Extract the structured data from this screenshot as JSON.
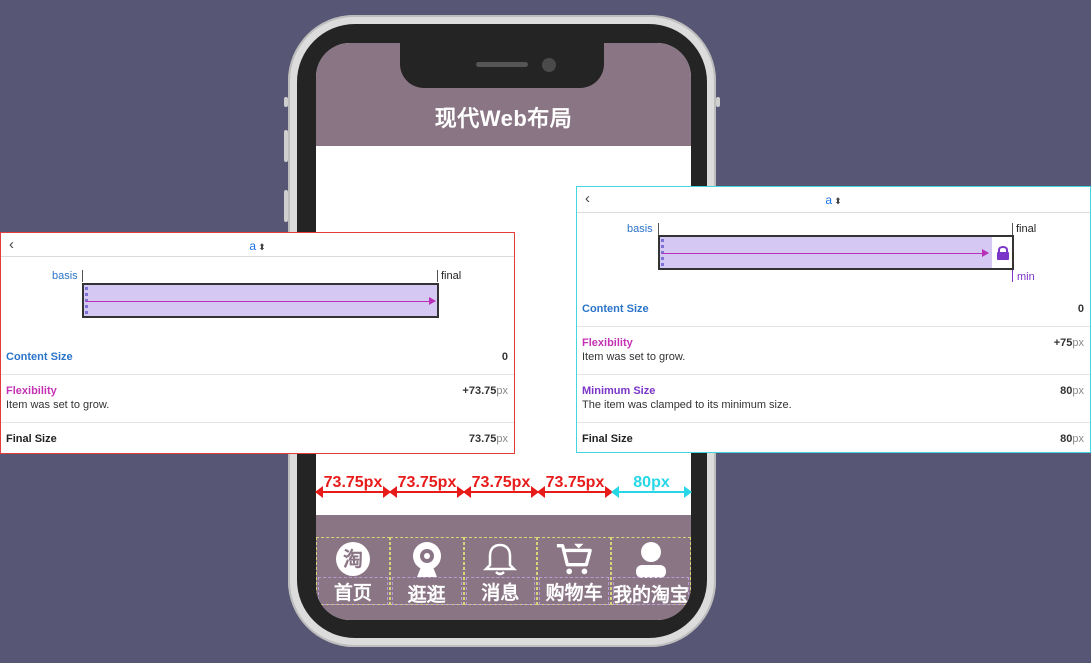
{
  "phone": {
    "app_title": "现代Web布局",
    "tabs": [
      {
        "label": "首页",
        "icon": "taobao-logo-icon"
      },
      {
        "label": "逛逛",
        "icon": "webcam-icon"
      },
      {
        "label": "消息",
        "icon": "bell-icon"
      },
      {
        "label": "购物车",
        "icon": "shopping-cart-icon"
      },
      {
        "label": "我的淘宝",
        "icon": "user-icon"
      }
    ],
    "logo_glyph": "淘",
    "measurements": [
      "73.75px",
      "73.75px",
      "73.75px",
      "73.75px",
      "80px"
    ],
    "measure_colors": [
      "#e81b1b",
      "#e81b1b",
      "#e81b1b",
      "#e81b1b",
      "#27d7e6"
    ]
  },
  "left_panel": {
    "back": "‹",
    "selector": "a",
    "selector_arrow": "⬍",
    "basis_label": "basis",
    "final_label": "final",
    "rows": {
      "content_size": {
        "name": "Content Size",
        "value": "0"
      },
      "flexibility": {
        "name": "Flexibility",
        "desc": "Item was set to grow.",
        "value": "+73.75",
        "unit": "px"
      },
      "final_size": {
        "name": "Final Size",
        "value": "73.75",
        "unit": "px"
      }
    }
  },
  "right_panel": {
    "back": "‹",
    "selector": "a",
    "selector_arrow": "⬍",
    "basis_label": "basis",
    "final_label": "final",
    "min_label": "min",
    "rows": {
      "content_size": {
        "name": "Content Size",
        "value": "0"
      },
      "flexibility": {
        "name": "Flexibility",
        "desc": "Item was set to grow.",
        "value": "+75",
        "unit": "px"
      },
      "minimum_size": {
        "name": "Minimum Size",
        "desc": "The item was clamped to its minimum size.",
        "value": "80",
        "unit": "px"
      },
      "final_size": {
        "name": "Final Size",
        "value": "80",
        "unit": "px"
      }
    }
  },
  "colors": {
    "background": "#575674",
    "header": "#8a7585",
    "measure_red": "#e81b1b",
    "measure_cyan": "#27d7e6",
    "left_panel_border": "#e23c3c",
    "right_panel_border": "#45d5de"
  }
}
